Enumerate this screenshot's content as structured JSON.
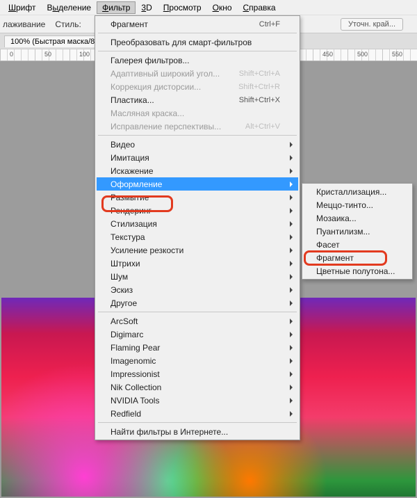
{
  "menu": {
    "items": [
      "Шрифт",
      "Выделение",
      "Фильтр",
      "3D",
      "Просмотр",
      "Окно",
      "Справка"
    ],
    "active_index": 2,
    "underline_index": [
      0,
      1,
      0,
      0,
      0,
      0,
      0
    ]
  },
  "options": {
    "anti_alias_label": "лаживание",
    "style_label": "Стиль:",
    "refine_edge_label": "Уточн. край..."
  },
  "tab": {
    "title": "100% (Быстрая маска/8"
  },
  "ruler_marks": [
    0,
    50,
    100,
    450,
    500,
    550
  ],
  "filter_menu": {
    "items": [
      {
        "type": "item",
        "label": "Фрагмент",
        "shortcut": "Ctrl+F"
      },
      {
        "type": "sep"
      },
      {
        "type": "item",
        "label": "Преобразовать для смарт-фильтров"
      },
      {
        "type": "sep"
      },
      {
        "type": "item",
        "label": "Галерея фильтров..."
      },
      {
        "type": "item",
        "label": "Адаптивный широкий угол...",
        "shortcut": "Shift+Ctrl+A",
        "disabled": true
      },
      {
        "type": "item",
        "label": "Коррекция дисторсии...",
        "shortcut": "Shift+Ctrl+R",
        "disabled": true
      },
      {
        "type": "item",
        "label": "Пластика...",
        "shortcut": "Shift+Ctrl+X"
      },
      {
        "type": "item",
        "label": "Масляная краска...",
        "disabled": true
      },
      {
        "type": "item",
        "label": "Исправление перспективы...",
        "shortcut": "Alt+Ctrl+V",
        "disabled": true
      },
      {
        "type": "sep"
      },
      {
        "type": "item",
        "label": "Видео",
        "submenu": true
      },
      {
        "type": "item",
        "label": "Имитация",
        "submenu": true
      },
      {
        "type": "item",
        "label": "Искажение",
        "submenu": true
      },
      {
        "type": "item",
        "label": "Оформление",
        "submenu": true,
        "highlight": true
      },
      {
        "type": "item",
        "label": "Размытие",
        "submenu": true
      },
      {
        "type": "item",
        "label": "Рендеринг",
        "submenu": true
      },
      {
        "type": "item",
        "label": "Стилизация",
        "submenu": true
      },
      {
        "type": "item",
        "label": "Текстура",
        "submenu": true
      },
      {
        "type": "item",
        "label": "Усиление резкости",
        "submenu": true
      },
      {
        "type": "item",
        "label": "Штрихи",
        "submenu": true
      },
      {
        "type": "item",
        "label": "Шум",
        "submenu": true
      },
      {
        "type": "item",
        "label": "Эскиз",
        "submenu": true
      },
      {
        "type": "item",
        "label": "Другое",
        "submenu": true
      },
      {
        "type": "sep"
      },
      {
        "type": "item",
        "label": "ArcSoft",
        "submenu": true
      },
      {
        "type": "item",
        "label": "Digimarc",
        "submenu": true
      },
      {
        "type": "item",
        "label": "Flaming Pear",
        "submenu": true
      },
      {
        "type": "item",
        "label": "Imagenomic",
        "submenu": true
      },
      {
        "type": "item",
        "label": "Impressionist",
        "submenu": true
      },
      {
        "type": "item",
        "label": "Nik Collection",
        "submenu": true
      },
      {
        "type": "item",
        "label": "NVIDIA Tools",
        "submenu": true
      },
      {
        "type": "item",
        "label": "Redfield",
        "submenu": true
      },
      {
        "type": "sep"
      },
      {
        "type": "item",
        "label": "Найти фильтры в Интернете..."
      }
    ]
  },
  "submenu_pixelate": {
    "items": [
      "Кристаллизация...",
      "Меццо-тинто...",
      "Мозаика...",
      "Пуантилизм...",
      "Фасет",
      "Фрагмент",
      "Цветные полутона..."
    ],
    "ring_index": 5
  },
  "highlight_rings": {
    "main_label": "Оформление",
    "sub_label": "Фрагмент"
  }
}
